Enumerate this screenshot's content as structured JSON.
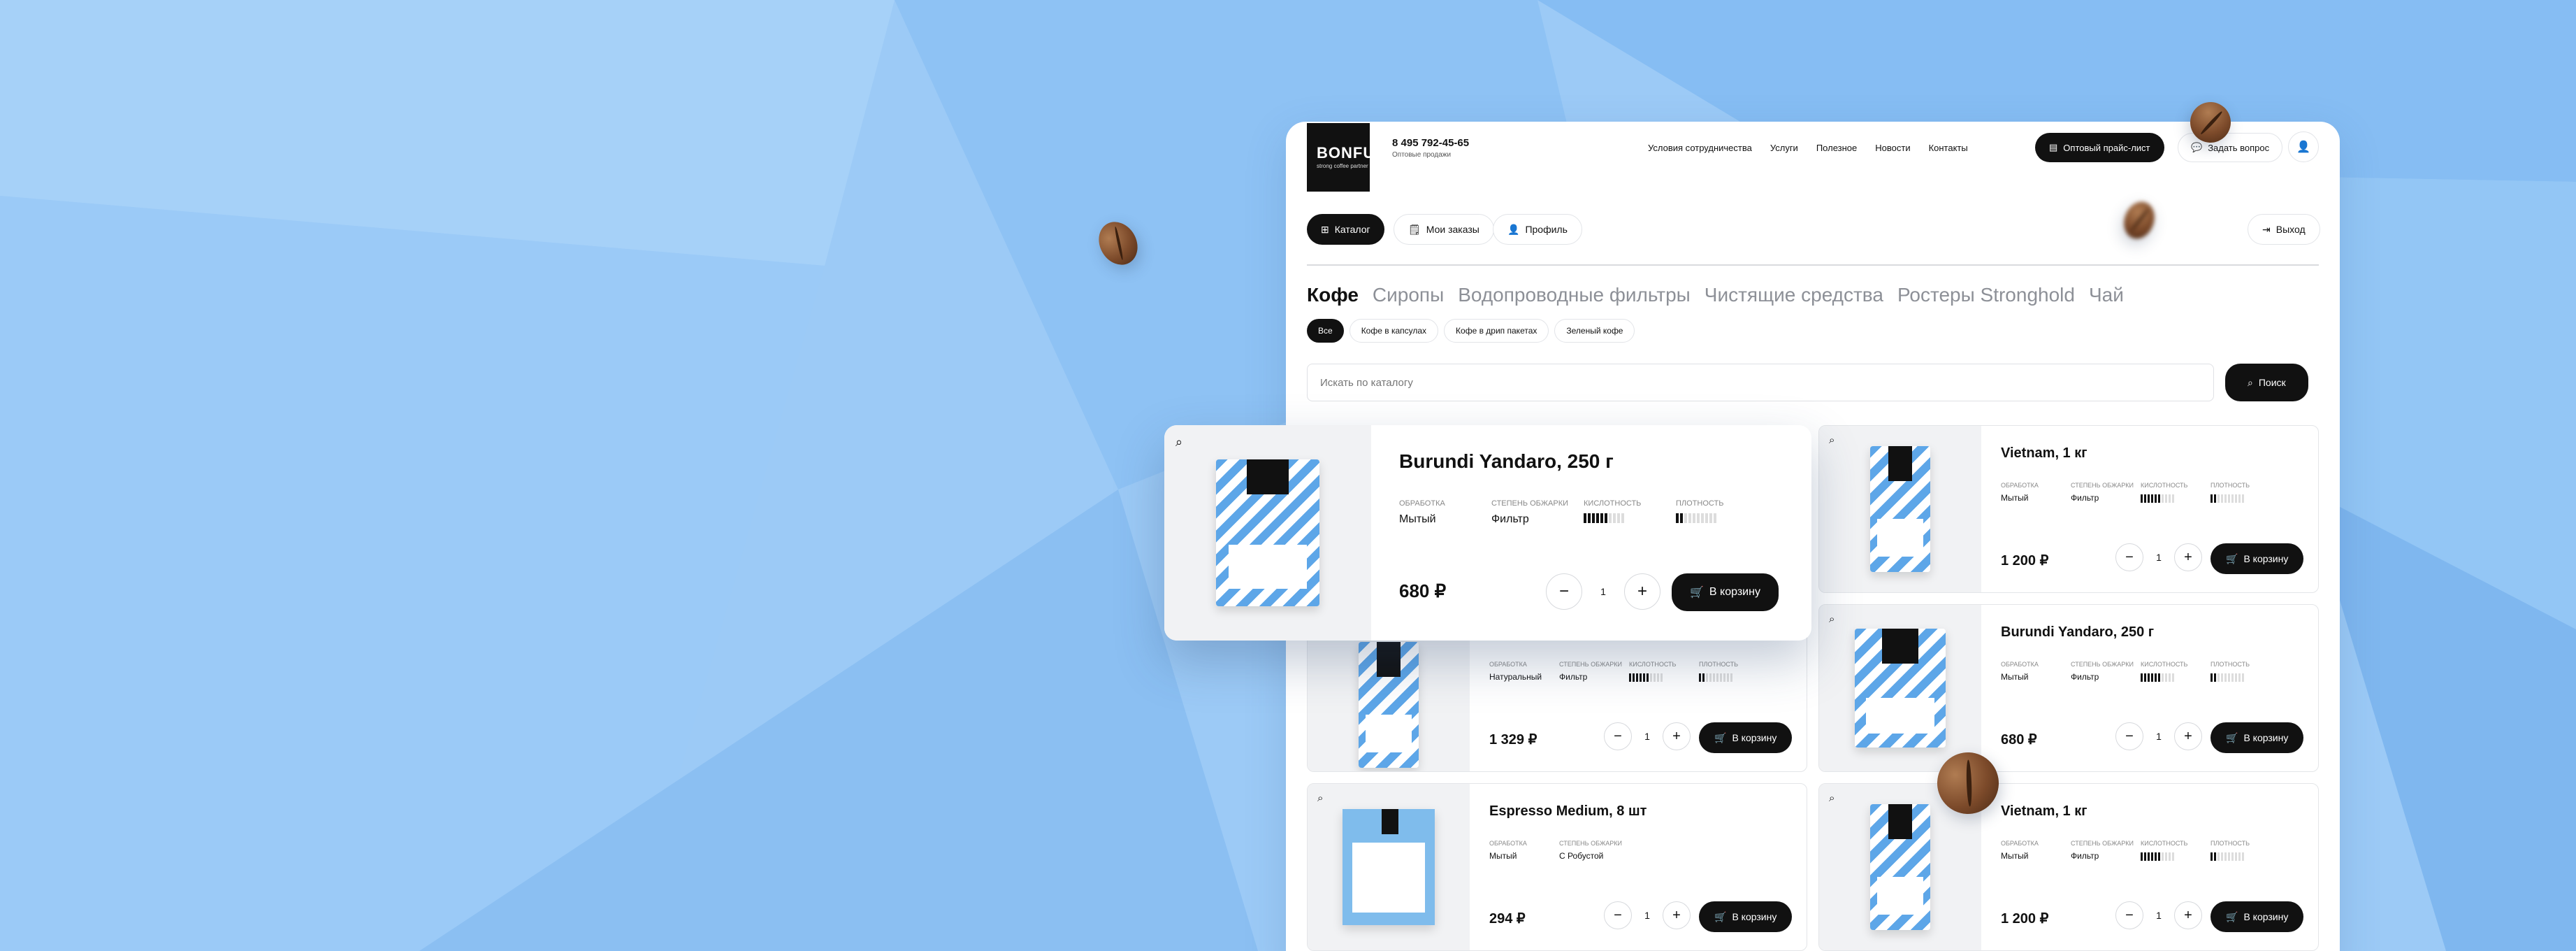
{
  "header": {
    "logo_text": "BONFUSE",
    "logo_tagline": "strong coffee partner",
    "phone": "8 495 792-45-65",
    "phone_caption": "Оптовые продажи",
    "nav": [
      "Условия сотрудничества",
      "Услуги",
      "Полезное",
      "Новости",
      "Контакты"
    ],
    "pricelist_label": "Оптовый прайс-лист",
    "ask_label": "Задать вопрос"
  },
  "account_nav": {
    "catalog": "Каталог",
    "orders": "Мои заказы",
    "profile": "Профиль",
    "logout": "Выход"
  },
  "categories": [
    "Кофе",
    "Сиропы",
    "Водопроводные фильтры",
    "Чистящие средства",
    "Ростеры Stronghold",
    "Чай"
  ],
  "subcategories": [
    "Все",
    "Кофе в капсулах",
    "Кофе в дрип пакетах",
    "Зеленый кофе"
  ],
  "search": {
    "placeholder": "Искать по каталогу",
    "button": "Поиск"
  },
  "attr_labels": {
    "processing": "ОБРАБОТКА",
    "roast": "СТЕПЕНЬ ОБЖАРКИ",
    "acidity": "КИСЛОТНОСТЬ",
    "density": "ПЛОТНОСТЬ"
  },
  "cart_label": "В корзину",
  "featured": {
    "title": "Burundi Yandaro, 250 г",
    "processing": "Мытый",
    "roast": "Фильтр",
    "price": "680 ₽",
    "qty": "1",
    "acidity_level": 6,
    "density_level": 2,
    "max_level": 10
  },
  "products": [
    {
      "title": "Vietnam, 1 кг",
      "processing": "Мытый",
      "roast": "Фильтр",
      "price": "1 200 ₽",
      "qty": "1",
      "acidity_level": 6,
      "density_level": 2
    },
    {
      "title": "",
      "processing": "Натуральный",
      "roast": "Фильтр",
      "price": "1 329 ₽",
      "qty": "1",
      "acidity_level": 6,
      "density_level": 2
    },
    {
      "title": "Burundi Yandaro, 250 г",
      "processing": "Мытый",
      "roast": "Фильтр",
      "price": "680 ₽",
      "qty": "1",
      "acidity_level": 6,
      "density_level": 2
    },
    {
      "title": "Espresso Medium, 8 шт",
      "processing": "Мытый",
      "roast": "С Робустой",
      "price": "294 ₽",
      "qty": "1",
      "acidity_level": 0,
      "density_level": 0
    },
    {
      "title": "Vietnam, 1 кг",
      "processing": "Мытый",
      "roast": "Фильтр",
      "price": "1 200 ₽",
      "qty": "1",
      "acidity_level": 6,
      "density_level": 2
    }
  ],
  "colors": {
    "background": "#9ccaf6",
    "accent": "#111111",
    "pack_blue": "#5da6e8"
  },
  "icons": [
    "search-icon",
    "catalog-grid-icon",
    "orders-icon",
    "profile-icon",
    "logout-icon",
    "chat-icon",
    "pricelist-icon",
    "user-icon",
    "cart-icon",
    "minus-icon",
    "plus-icon"
  ]
}
